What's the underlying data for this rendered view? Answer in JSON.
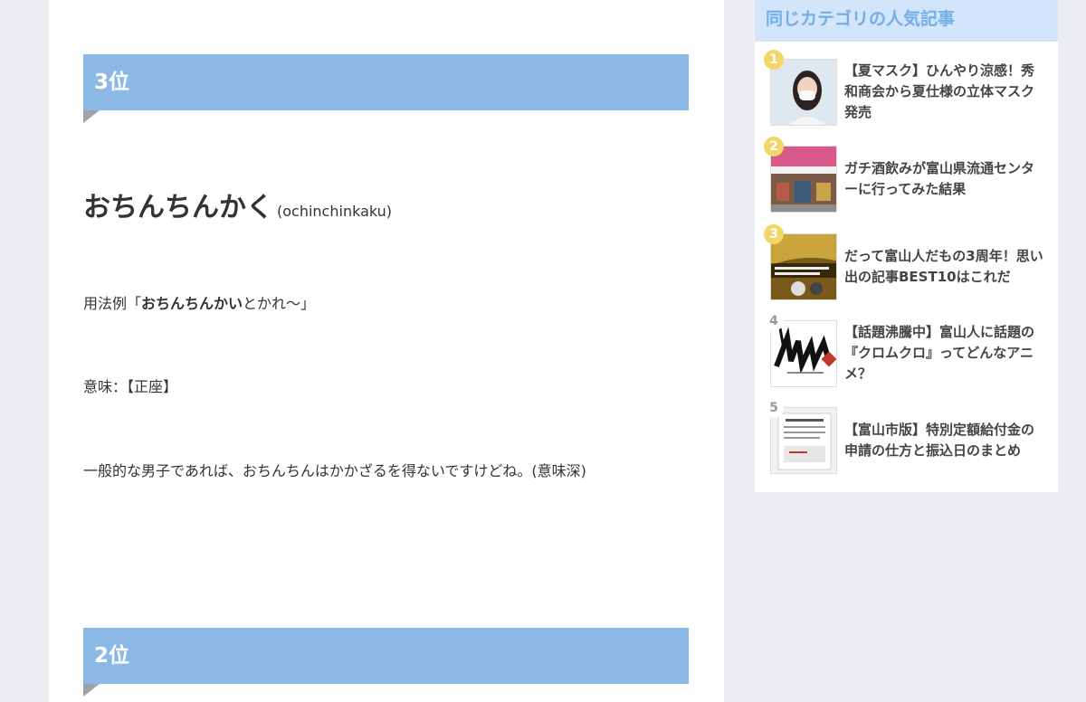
{
  "article": {
    "rank3_heading": "3位",
    "word_main": "おちんちんかく",
    "word_reading": "(ochinchinkaku)",
    "usage_prefix": "用法例「",
    "usage_bold": "おちんちんかい",
    "usage_suffix": "とかれ〜」",
    "meaning": "意味：【正座】",
    "note": "一般的な男子であれば、おちんちんはかかざるを得ないですけどね。(意味深)",
    "rank2_heading": "2位"
  },
  "sidebar": {
    "title": "同じカテゴリの人気記事",
    "items": [
      {
        "rank": "1",
        "title": "【夏マスク】ひんやり涼感！秀和商会から夏仕様の立体マスク発売"
      },
      {
        "rank": "2",
        "title": "ガチ酒飲みが富山県流通センターに行ってみた結果"
      },
      {
        "rank": "3",
        "title": "だって富山人だもの3周年！思い出の記事BEST10はこれだ"
      },
      {
        "rank": "4",
        "title": "【話題沸騰中】富山人に話題の『クロムクロ』ってどんなアニメ？"
      },
      {
        "rank": "5",
        "title": "【富山市版】特別定額給付金の申請の仕方と振込日のまとめ"
      }
    ]
  },
  "colors": {
    "heading_bg": "#8bb8e4",
    "sidebar_title_bg": "#d2e5fb",
    "sidebar_title_text": "#74aee6",
    "badge_gold": "#f2d668"
  }
}
